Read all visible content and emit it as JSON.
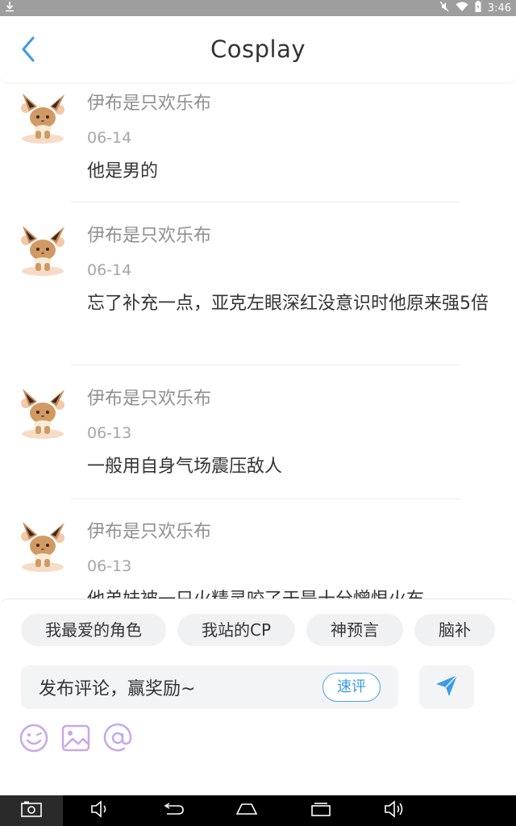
{
  "status_bar": {
    "time": "3:46"
  },
  "header": {
    "title": "Cosplay"
  },
  "comments": [
    {
      "username": "伊布是只欢乐布",
      "date": "06-14",
      "text": "他是男的"
    },
    {
      "username": "伊布是只欢乐布",
      "date": "06-14",
      "text": "忘了补充一点，亚克左眼深红没意识时他原来强5倍"
    },
    {
      "username": "伊布是只欢乐布",
      "date": "06-13",
      "text": "一般用自身气场震压敌人"
    },
    {
      "username": "伊布是只欢乐布",
      "date": "06-13",
      "text": "他弟妹被一只火精灵咬了于是十分憎恨火布"
    }
  ],
  "tags": [
    "我最爱的角色",
    "我站的CP",
    "神预言",
    "脑补"
  ],
  "input": {
    "placeholder": "发布评论，赢奖励~",
    "quick_label": "速评"
  },
  "colors": {
    "accent": "#3b9be6",
    "tool_icon": "#c9a7e8",
    "tag_bg": "#f0f1f3"
  },
  "icons": {
    "back": "chevron-left-icon",
    "send": "paper-plane-icon",
    "tools": [
      "emoji-icon",
      "image-icon",
      "at-icon"
    ],
    "nav": [
      "screenshot-icon",
      "volume-down-icon",
      "back-icon",
      "home-icon",
      "recents-icon",
      "volume-up-icon"
    ]
  }
}
